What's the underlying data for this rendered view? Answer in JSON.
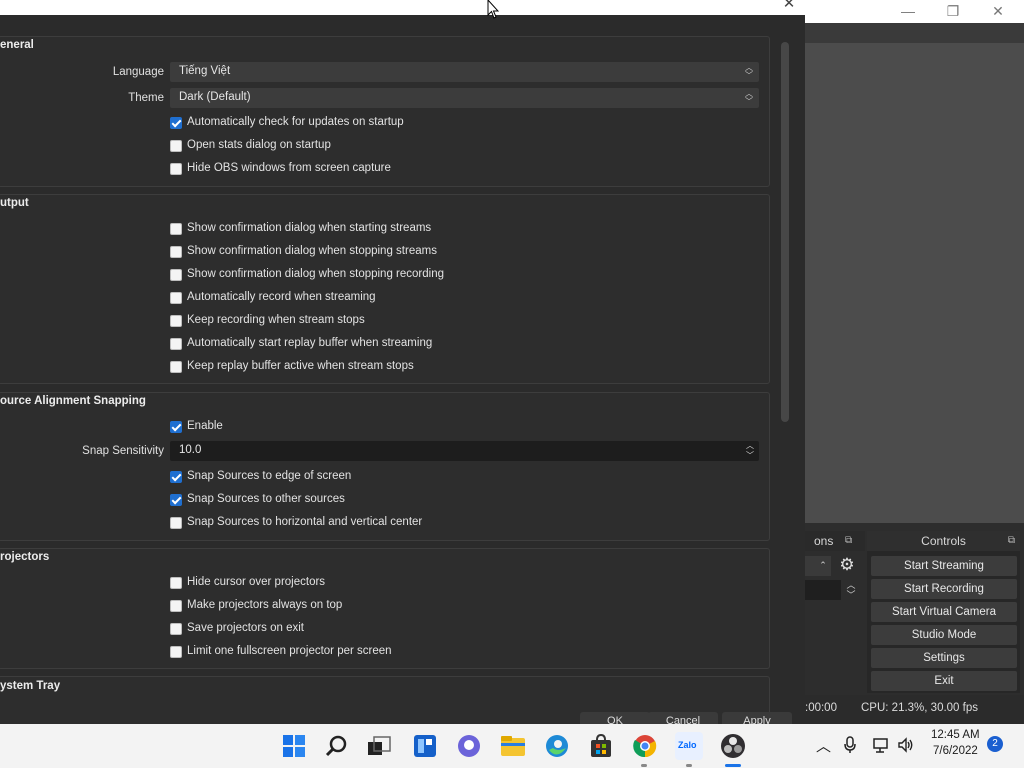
{
  "obs_main": {
    "window_controls": {
      "minimize": "—",
      "maximize": "❐",
      "close": "✕"
    },
    "transitions_dock_title": "ons",
    "controls": {
      "title": "Controls",
      "buttons": [
        "Start Streaming",
        "Start Recording",
        "Start Virtual Camera",
        "Studio Mode",
        "Settings",
        "Exit"
      ]
    },
    "status": {
      "time": ":00:00",
      "cpu": "CPU: 21.3%, 30.00 fps"
    }
  },
  "dialog": {
    "close_glyph": "✕",
    "sections": {
      "general": {
        "title": "eneral",
        "language_label": "Language",
        "language_value": "Tiếng Việt",
        "theme_label": "Theme",
        "theme_value": "Dark (Default)",
        "checks": [
          {
            "label": "Automatically check for updates on startup",
            "checked": true
          },
          {
            "label": "Open stats dialog on startup",
            "checked": false
          },
          {
            "label": "Hide OBS windows from screen capture",
            "checked": false
          }
        ]
      },
      "output": {
        "title": "utput",
        "checks": [
          {
            "label": "Show confirmation dialog when starting streams",
            "checked": false
          },
          {
            "label": "Show confirmation dialog when stopping streams",
            "checked": false
          },
          {
            "label": "Show confirmation dialog when stopping recording",
            "checked": false
          },
          {
            "label": "Automatically record when streaming",
            "checked": false
          },
          {
            "label": "Keep recording when stream stops",
            "checked": false
          },
          {
            "label": "Automatically start replay buffer when streaming",
            "checked": false
          },
          {
            "label": "Keep replay buffer active when stream stops",
            "checked": false
          }
        ]
      },
      "snapping": {
        "title": "ource Alignment Snapping",
        "enable": {
          "label": "Enable",
          "checked": true
        },
        "sensitivity_label": "Snap Sensitivity",
        "sensitivity_value": "10.0",
        "checks": [
          {
            "label": "Snap Sources to edge of screen",
            "checked": true
          },
          {
            "label": "Snap Sources to other sources",
            "checked": true
          },
          {
            "label": "Snap Sources to horizontal and vertical center",
            "checked": false
          }
        ]
      },
      "projectors": {
        "title": "rojectors",
        "checks": [
          {
            "label": "Hide cursor over projectors",
            "checked": false
          },
          {
            "label": "Make projectors always on top",
            "checked": false
          },
          {
            "label": "Save projectors on exit",
            "checked": false
          },
          {
            "label": "Limit one fullscreen projector per screen",
            "checked": false
          }
        ]
      },
      "system_tray": {
        "title": "ystem Tray"
      }
    },
    "buttons": {
      "ok": "OK",
      "cancel": "Cancel",
      "apply": "Apply"
    }
  },
  "taskbar": {
    "apps": [
      "start-icon",
      "search-icon",
      "task-view-icon",
      "widgets-icon",
      "chat-icon",
      "file-explorer-icon",
      "edge-icon",
      "store-icon",
      "chrome-icon",
      "zalo-icon",
      "obs-icon"
    ],
    "zalo_label": "Zalo",
    "clock_time": "12:45 AM",
    "clock_date": "7/6/2022",
    "notification_count": "2"
  }
}
